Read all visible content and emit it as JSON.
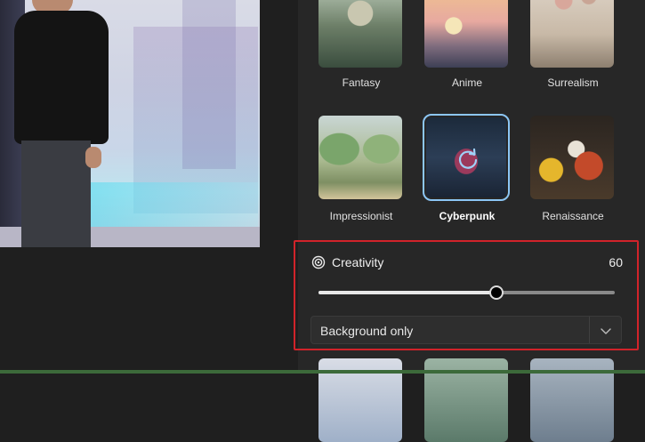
{
  "styles": {
    "row1": [
      {
        "label": "Fantasy",
        "selected": false
      },
      {
        "label": "Anime",
        "selected": false
      },
      {
        "label": "Surrealism",
        "selected": false
      }
    ],
    "row2": [
      {
        "label": "Impressionist",
        "selected": false
      },
      {
        "label": "Cyberpunk",
        "selected": true
      },
      {
        "label": "Renaissance",
        "selected": false
      }
    ]
  },
  "creativity": {
    "label": "Creativity",
    "value": "60",
    "slider_value": 0.6
  },
  "scope_dropdown": {
    "selected": "Background only"
  },
  "colors": {
    "panel_bg": "#272727",
    "selection_outline": "#8cc6f5",
    "highlight_box": "#d1232a"
  }
}
